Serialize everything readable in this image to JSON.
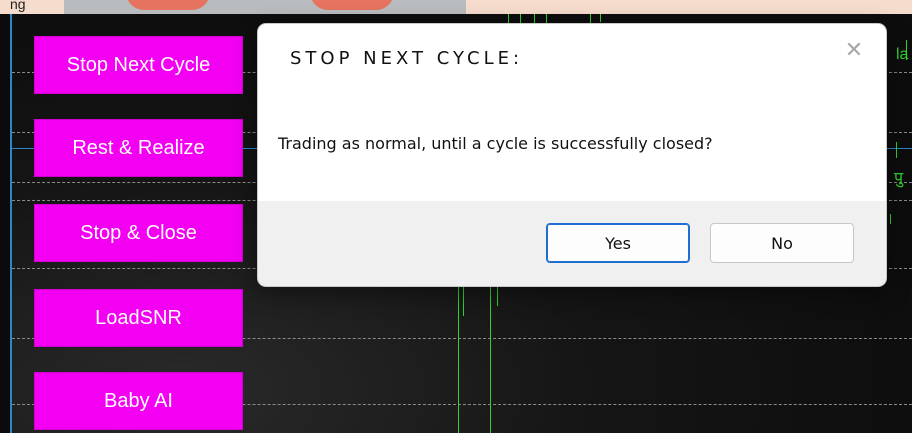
{
  "top_strip": {
    "cut_text": "ng"
  },
  "buttons": [
    {
      "label": "Stop Next Cycle"
    },
    {
      "label": "Rest & Realize"
    },
    {
      "label": "Stop & Close"
    },
    {
      "label": "LoadSNR"
    },
    {
      "label": "Baby AI"
    }
  ],
  "side_labels": {
    "top": "la",
    "middle": "पु"
  },
  "dialog": {
    "title": "STOP NEXT CYCLE:",
    "close_glyph": "✕",
    "message": "Trading as normal, until a cycle is successfully closed?",
    "yes_label": "Yes",
    "no_label": "No"
  },
  "colors": {
    "button_bg": "#f300f3",
    "grid": "#8a8a8a",
    "accent_blue": "#2a86cf",
    "chart_green": "#2fd42f",
    "primary_focus": "#1f6fd1"
  }
}
